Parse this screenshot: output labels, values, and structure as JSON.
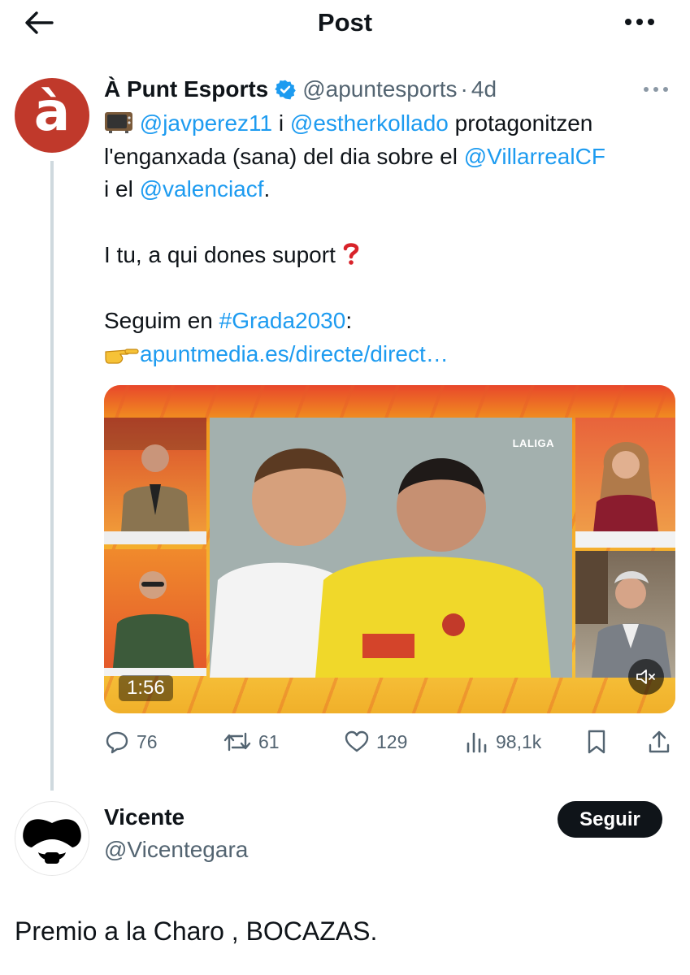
{
  "header": {
    "title": "Post"
  },
  "tweet": {
    "author_name": "À Punt Esports",
    "author_handle": "@apuntesports",
    "separator": "·",
    "time": "4d",
    "avatar_letter": "à",
    "text": {
      "mention1": "@javperez11",
      "conj1": " i ",
      "mention2": "@estherkollado",
      "l1_rest": " protagonitzen",
      "l2_start": "l'enganxada (sana) del dia sobre el ",
      "mention3": "@VillarrealCF",
      "l3_start": "i el ",
      "mention4": "@valenciacf",
      "l3_end": ".",
      "question": "I tu, a qui dones suport ",
      "follow_line_start": "Seguim en ",
      "hashtag": "#Grada2030",
      "follow_line_end": ":",
      "url": "apuntmedia.es/directe/direct…"
    },
    "media": {
      "duration": "1:56",
      "broadcaster_label": "LALIGA"
    },
    "stats": {
      "replies": "76",
      "reposts": "61",
      "likes": "129",
      "views": "98,1k"
    },
    "accent_color": "#1d9bf0"
  },
  "reply": {
    "author_name": "Vicente",
    "author_handle": "@Vicentegara",
    "follow_label": "Seguir",
    "text": "Premio a la Charo , BOCAZAS."
  }
}
